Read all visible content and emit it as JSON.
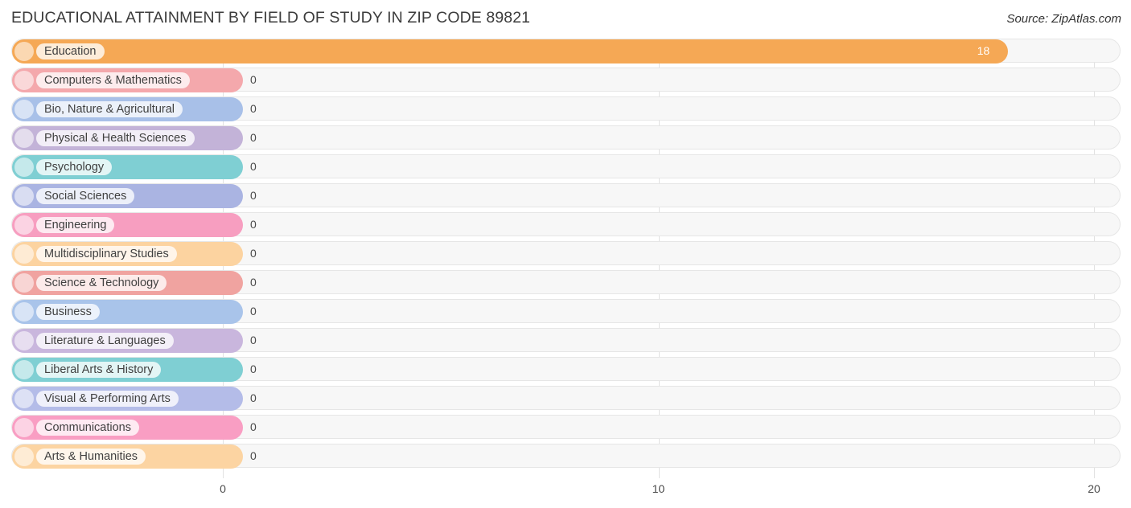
{
  "header": {
    "title": "EDUCATIONAL ATTAINMENT BY FIELD OF STUDY IN ZIP CODE 89821",
    "source": "Source: ZipAtlas.com"
  },
  "chart_data": {
    "type": "bar",
    "orientation": "horizontal",
    "title": "EDUCATIONAL ATTAINMENT BY FIELD OF STUDY IN ZIP CODE 89821",
    "xlabel": "",
    "ylabel": "",
    "xlim": [
      0,
      20
    ],
    "xticks": [
      "0",
      "10",
      "20"
    ],
    "xtick_values": [
      0,
      10,
      20
    ],
    "grid": true,
    "categories": [
      "Education",
      "Computers & Mathematics",
      "Bio, Nature & Agricultural",
      "Physical & Health Sciences",
      "Psychology",
      "Social Sciences",
      "Engineering",
      "Multidisciplinary Studies",
      "Science & Technology",
      "Business",
      "Literature & Languages",
      "Liberal Arts & History",
      "Visual & Performing Arts",
      "Communications",
      "Arts & Humanities"
    ],
    "values": [
      18,
      0,
      0,
      0,
      0,
      0,
      0,
      0,
      0,
      0,
      0,
      0,
      0,
      0,
      0
    ],
    "value_labels": [
      "18",
      "0",
      "0",
      "0",
      "0",
      "0",
      "0",
      "0",
      "0",
      "0",
      "0",
      "0",
      "0",
      "0",
      "0"
    ],
    "colors": [
      "#f5a855",
      "#f4a8ac",
      "#a8c0e8",
      "#c3b3d8",
      "#7fcfd3",
      "#aab4e2",
      "#f79ec0",
      "#fcd3a0",
      "#f0a3a0",
      "#a9c4ea",
      "#c9b6dd",
      "#7fcfd3",
      "#b4bce8",
      "#f99ec3",
      "#fcd4a2"
    ]
  }
}
